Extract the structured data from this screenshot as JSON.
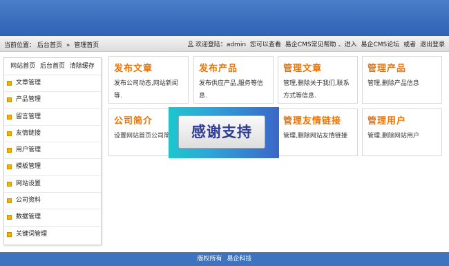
{
  "header": {
    "crumb_label": "当前位置：",
    "crumb_home": "后台首页",
    "crumb_sep": "»",
    "crumb_current": "管理首页",
    "welcome": "欢迎登陆：admin",
    "help_text": "您可以查看",
    "link_help": "易企CMS常见帮助",
    "sep1": "、进入",
    "link_forum": "易企CMS论坛",
    "sep2": "或者",
    "link_logout": "退出登录"
  },
  "sidebar": {
    "top_links": [
      "网站首页",
      "后台首页",
      "清除缓存"
    ],
    "items": [
      "文章管理",
      "产品管理",
      "留言管理",
      "友情链接",
      "用户管理",
      "模板管理",
      "网站设置",
      "公司资料",
      "数据管理",
      "关键词管理"
    ]
  },
  "cards": [
    {
      "title": "发布文章",
      "desc": "发布公司动态,网站新闻等."
    },
    {
      "title": "发布产品",
      "desc": "发布供应产品,服务等信息."
    },
    {
      "title": "管理文章",
      "desc": "管理,删除关于我们,联系方式等信息."
    },
    {
      "title": "管理产品",
      "desc": "管理,删除产品信息"
    },
    {
      "title": "公司简介",
      "desc": "设置网站首页公司简介"
    },
    {
      "title": "管理友情链接",
      "desc": "管理,删除网站友情链接"
    },
    {
      "title": "管理用户",
      "desc": "管理,删除网站用户"
    }
  ],
  "popup": {
    "text": "感谢支持"
  },
  "footer": {
    "left": "版权所有",
    "right": "易企科技"
  },
  "colors": {
    "header_blue": "#3d73bf",
    "title_orange": "#ef7300",
    "bullet": "#f0b400"
  },
  "icons": [
    "user-icon",
    "bullet-icon"
  ]
}
